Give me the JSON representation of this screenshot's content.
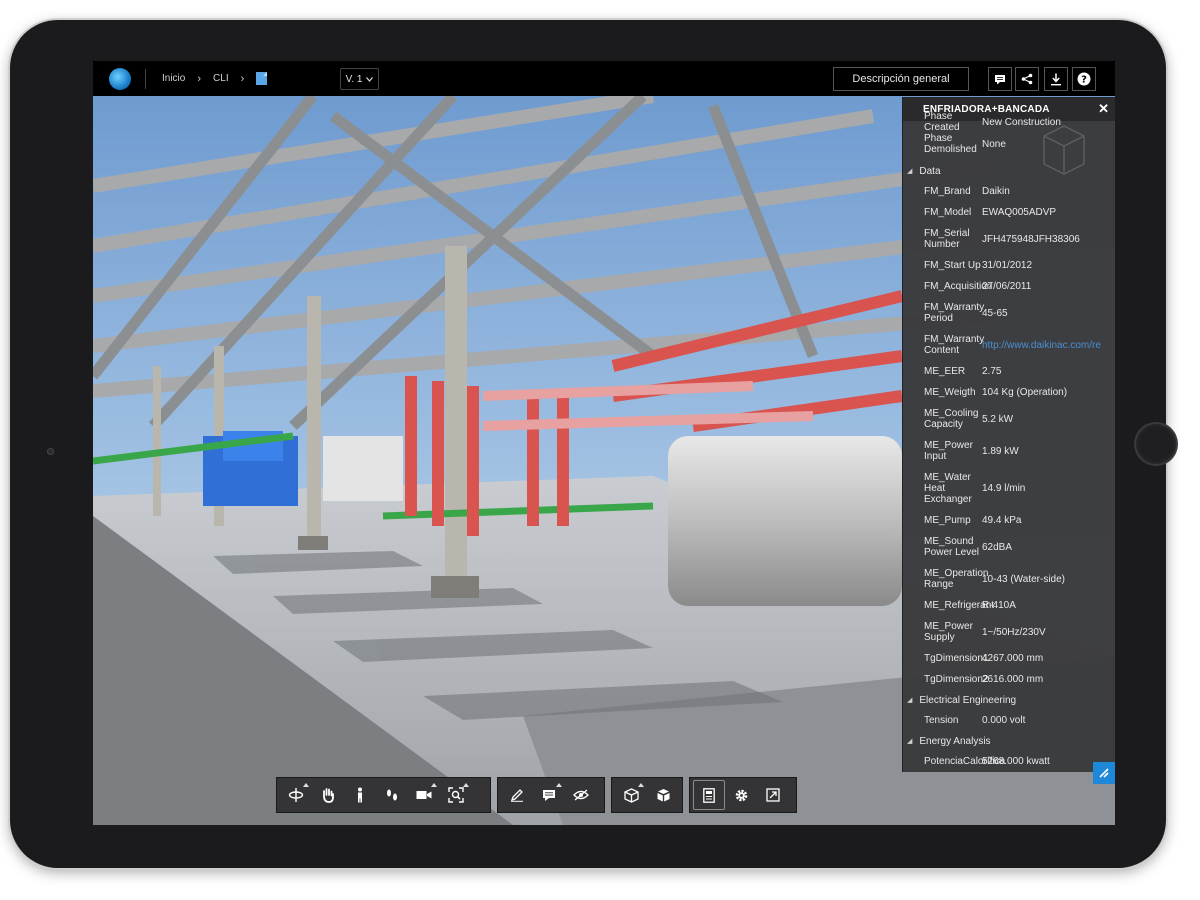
{
  "topbar": {
    "breadcrumb": [
      "Inicio",
      "CLI"
    ],
    "file_icon": "rvt-file-icon",
    "version": "V. 1",
    "description_button": "Descripción general",
    "icons": [
      "comment-icon",
      "share-icon",
      "download-icon",
      "help-icon"
    ]
  },
  "panel": {
    "title": "ENFRIADORA+BANCADA",
    "top_rows": [
      {
        "key": "Phase Created",
        "value": "New Construction"
      },
      {
        "key": "Phase Demolished",
        "value": "None"
      }
    ],
    "sections": [
      {
        "name": "Data",
        "rows": [
          {
            "key": "FM_Brand",
            "value": "Daikin"
          },
          {
            "key": "FM_Model",
            "value": "EWAQ005ADVP"
          },
          {
            "key": "FM_Serial Number",
            "value": "JFH475948JFH38306"
          },
          {
            "key": "FM_Start Up",
            "value": "31/01/2012"
          },
          {
            "key": "FM_Acquisition",
            "value": "27/06/2011"
          },
          {
            "key": "FM_Warranty Period",
            "value": "45-65"
          },
          {
            "key": "FM_Warranty Content",
            "value": "http://www.daikinac.com/re",
            "link": true
          },
          {
            "key": "ME_EER",
            "value": "2.75"
          },
          {
            "key": "ME_Weigth",
            "value": "104 Kg (Operation)"
          },
          {
            "key": "ME_Cooling Capacity",
            "value": "5.2 kW"
          },
          {
            "key": "ME_Power Input",
            "value": "1.89 kW"
          },
          {
            "key": "ME_Water Heat Exchanger",
            "value": "14.9 l/min"
          },
          {
            "key": "ME_Pump",
            "value": "49.4 kPa"
          },
          {
            "key": "ME_Sound Power Level",
            "value": "62dBA"
          },
          {
            "key": "ME_Operation Range",
            "value": "10-43 (Water-side)"
          },
          {
            "key": "ME_Refrigerant",
            "value": "R-410A"
          },
          {
            "key": "ME_Power Supply",
            "value": "1~/50Hz/230V"
          },
          {
            "key": "TgDimension1",
            "value": "4267.000 mm"
          },
          {
            "key": "TgDimension2",
            "value": "2616.000 mm"
          }
        ]
      },
      {
        "name": "Electrical Engineering",
        "rows": [
          {
            "key": "Tension",
            "value": "0.000 volt"
          }
        ]
      },
      {
        "name": "Energy Analysis",
        "rows": [
          {
            "key": "PotenciaCalorífica",
            "value": "5268.000 kwatt"
          }
        ]
      }
    ]
  },
  "toolbar": {
    "groups": [
      [
        "orbit-icon",
        "pan-icon",
        "walk-person-icon",
        "footsteps-icon",
        "camera-icon",
        "fit-view-icon"
      ],
      [
        "markup-pen-icon",
        "comment-balloon-icon",
        "hide-eye-icon"
      ],
      [
        "model-structure-icon",
        "explode-cube-icon"
      ],
      [
        "properties-icon",
        "settings-gear-icon",
        "fullscreen-icon"
      ]
    ]
  },
  "colors": {
    "sky": "#8fb4d9",
    "pipe_red": "#d9534f",
    "pipe_green": "#3aa64a",
    "chiller_blue": "#2f6fd6",
    "panel_bg": "#3a3a3c",
    "accent": "#1e88d8"
  }
}
